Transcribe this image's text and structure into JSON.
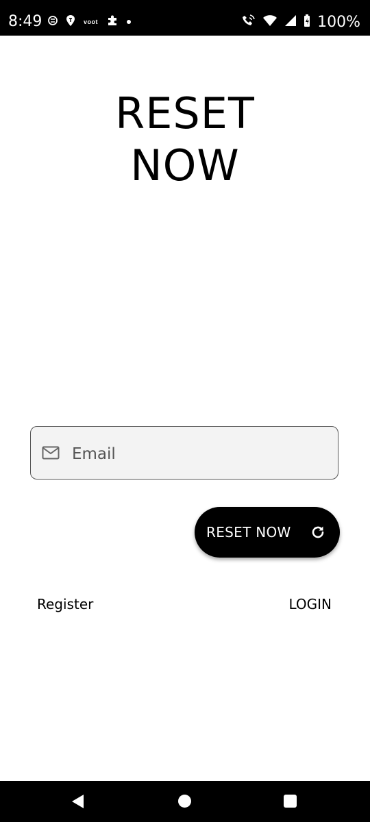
{
  "status_bar": {
    "time": "8:49",
    "battery": "100%",
    "left_icons": [
      "shazam-s-icon",
      "swiggy-pin-icon",
      "voot-logo-icon",
      "puzzle-icon",
      "notification-dot-icon"
    ],
    "right_icons": [
      "wifi-calling-icon",
      "wifi-icon",
      "cell-signal-icon",
      "battery-charging-icon"
    ],
    "voot_text": "voot"
  },
  "page": {
    "title_line1": "RESET",
    "title_line2": "NOW"
  },
  "form": {
    "email_placeholder": "Email",
    "email_value": "",
    "email_icon": "mail-icon",
    "reset_button_label": "RESET NOW",
    "reset_button_icon": "refresh-icon"
  },
  "links": {
    "register": "Register",
    "login": "LOGIN"
  },
  "nav_bar": {
    "icons": [
      "back-icon",
      "home-icon",
      "recents-icon"
    ]
  },
  "colors": {
    "background": "#ffffff",
    "bars": "#000000",
    "button": "#000000",
    "input_bg": "#f3f3f3",
    "input_border": "#555555"
  }
}
